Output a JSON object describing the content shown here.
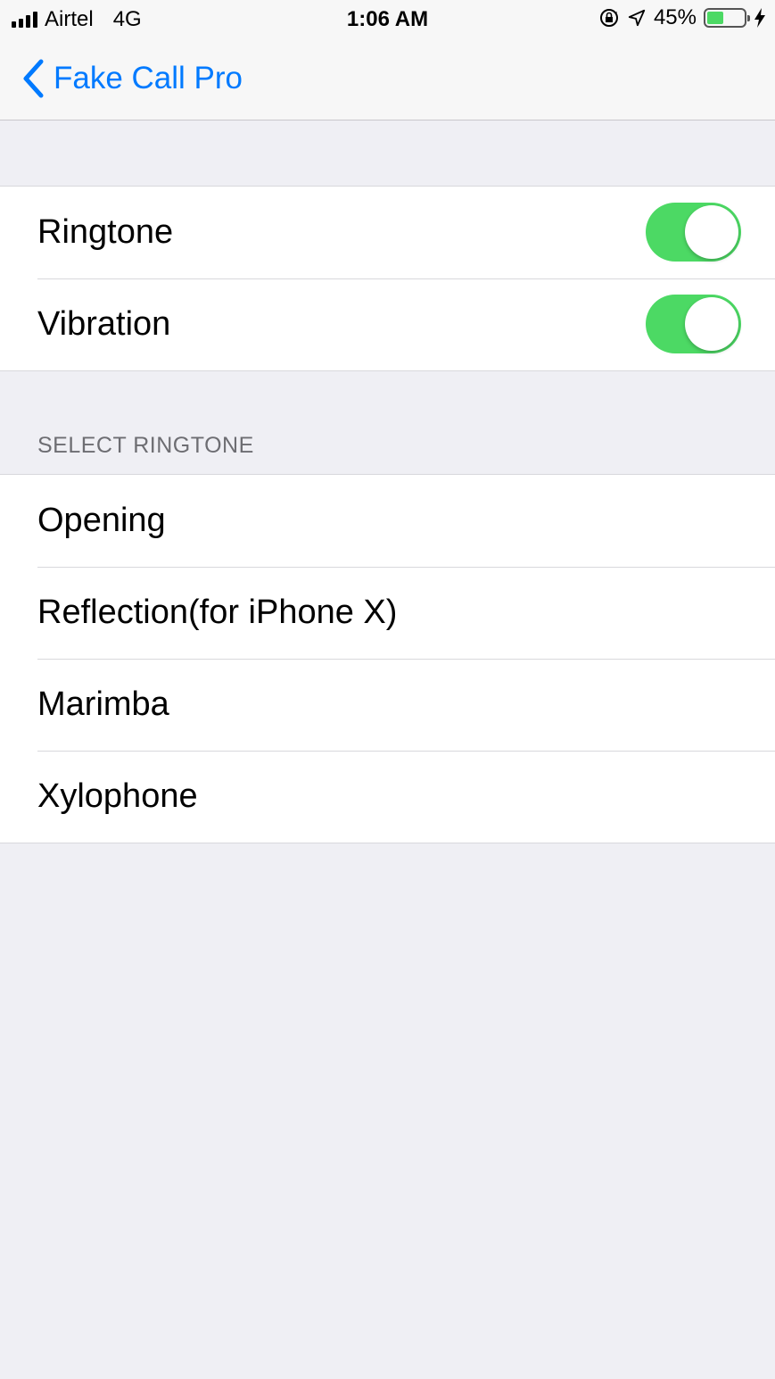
{
  "status_bar": {
    "carrier": "Airtel",
    "network": "4G",
    "time": "1:06 AM",
    "battery_percent": "45%",
    "battery_level": 0.45,
    "battery_color": "#4cd964"
  },
  "nav": {
    "back_label": "Fake Call Pro",
    "back_icon": "chevron-left-icon"
  },
  "settings": [
    {
      "label": "Ringtone",
      "enabled": true
    },
    {
      "label": "Vibration",
      "enabled": true
    }
  ],
  "ringtone_section": {
    "header": "SELECT RINGTONE",
    "items": [
      "Opening",
      "Reflection(for iPhone X)",
      "Marimba",
      "Xylophone"
    ]
  },
  "colors": {
    "accent": "#007aff",
    "toggle_on": "#4cd964",
    "background": "#efeff4"
  }
}
